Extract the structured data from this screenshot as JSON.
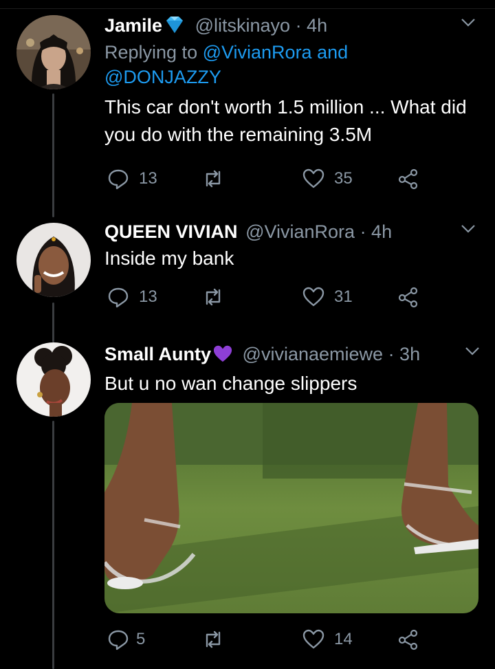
{
  "tweets": [
    {
      "name": "Jamile",
      "handle": "@litskinayo",
      "time": "· 4h",
      "replying_prefix": "Replying to ",
      "replying_to_1": "@VivianRora",
      "replying_and": " and",
      "replying_to_2": "@DONJAZZY",
      "text": "This car don't worth 1.5 million ... What did you do with the remaining 3.5M",
      "replies": "13",
      "retweets": "",
      "likes": "35",
      "has_badge": "diamond"
    },
    {
      "name": "QUEEN VIVIAN",
      "handle": "@VivianRora",
      "time": "· 4h",
      "text": "Inside my bank",
      "replies": "13",
      "retweets": "",
      "likes": "31"
    },
    {
      "name": "Small Aunty",
      "handle": "@vivianaemiewe",
      "time": "· 3h",
      "text": "But u no wan  change slippers",
      "replies": "5",
      "retweets": "",
      "likes": "14",
      "has_badge": "purple-heart"
    }
  ],
  "colors": {
    "background": "#000000",
    "secondary_text": "#8b98a5",
    "link": "#1d9bf0"
  }
}
